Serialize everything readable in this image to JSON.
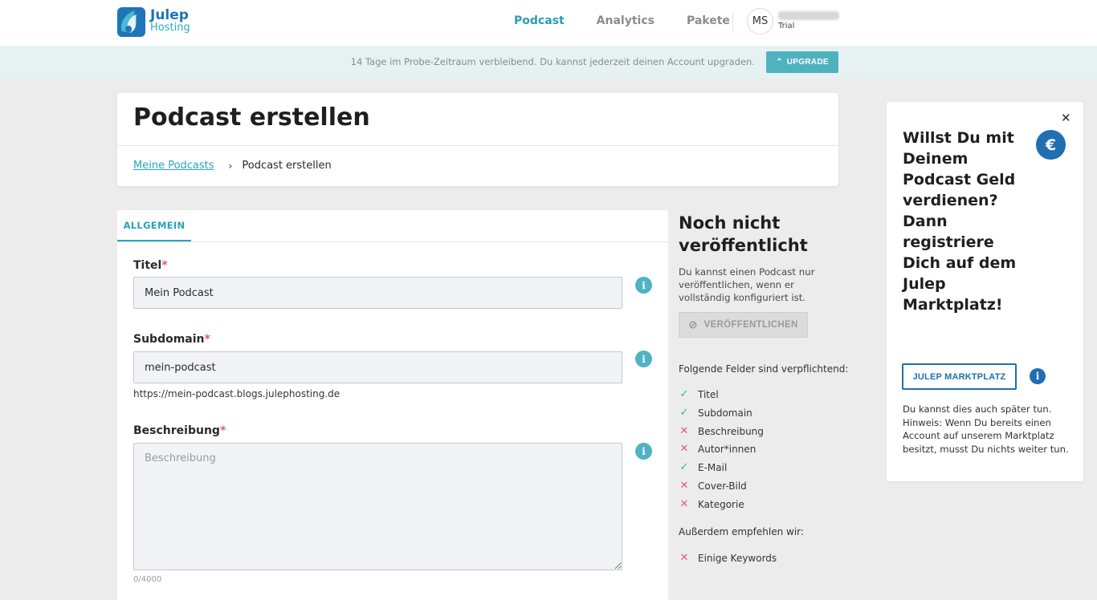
{
  "header": {
    "logo_line1": "Julep",
    "logo_line2": "Hosting",
    "nav": [
      "Podcast",
      "Analytics",
      "Pakete"
    ],
    "avatar_initials": "MS",
    "user_plan": "Trial"
  },
  "trial_bar": {
    "text": "14 Tage im Probe-Zeitraum verbleibend. Du kannst jederzeit deinen Account upgraden.",
    "upgrade_label": "UPGRADE"
  },
  "title_card": {
    "title": "Podcast erstellen",
    "breadcrumb_link": "Meine Podcasts",
    "breadcrumb_current": "Podcast erstellen"
  },
  "form": {
    "tab": "ALLGEMEIN",
    "title_label": "Titel",
    "title_value": "Mein Podcast",
    "subdomain_label": "Subdomain",
    "subdomain_value": "mein-podcast",
    "subdomain_url": "https://mein-podcast.blogs.julephosting.de",
    "description_label": "Beschreibung",
    "description_placeholder": "Beschreibung",
    "description_counter": "0/4000",
    "required_mark": "*"
  },
  "status": {
    "title": "Noch nicht veröffentlicht",
    "description": "Du kannst einen Podcast nur veröffentlichen, wenn er vollständig konfiguriert ist.",
    "publish_label": "VERÖFFENTLICHEN",
    "required_title": "Folgende Felder sind verpflichtend:",
    "required_items": [
      {
        "label": "Titel",
        "done": true
      },
      {
        "label": "Subdomain",
        "done": true
      },
      {
        "label": "Beschreibung",
        "done": false
      },
      {
        "label": "Autor*innen",
        "done": false
      },
      {
        "label": "E-Mail",
        "done": true
      },
      {
        "label": "Cover-Bild",
        "done": false
      },
      {
        "label": "Kategorie",
        "done": false
      }
    ],
    "recommend_title": "Außerdem empfehlen wir:",
    "recommend_items": [
      {
        "label": "Einige Keywords",
        "done": false
      }
    ]
  },
  "promo": {
    "title": "Willst Du mit Deinem Podcast Geld verdienen? Dann registriere Dich auf dem Julep Marktplatz!",
    "button_label": "JULEP MARKTPLATZ",
    "note": "Du kannst dies auch später tun. Hinweis: Wenn Du bereits einen Account auf unserem Marktplatz besitzt, musst Du nichts weiter tun."
  },
  "colors": {
    "accent": "#2aa3bb",
    "brand": "#1f6fb2",
    "ok": "#3cb479",
    "error": "#e05b6b"
  }
}
